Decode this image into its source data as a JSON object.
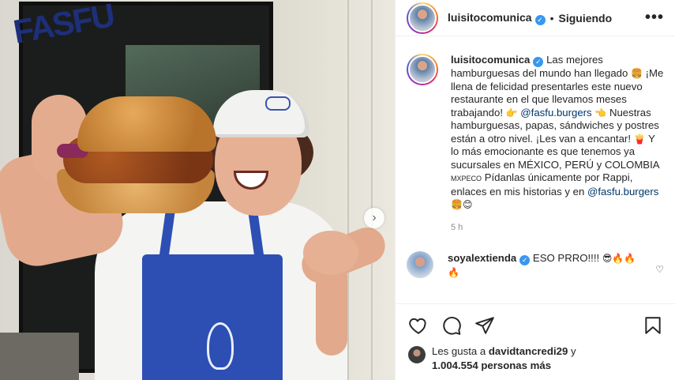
{
  "post": {
    "author": "luisitocomunica",
    "follow_status": "Siguiendo",
    "more_options": "•••",
    "separator": "•",
    "caption": {
      "part1": "Las mejores hamburguesas del mundo han llegado",
      "emoji1": "🍔",
      "part2": "¡Me llena de felicidad presentarles este nuevo restaurante en el que llevamos meses trabajando!",
      "emoji2": "👉",
      "mention1": "@fasfu.burgers",
      "emoji3": "👈",
      "part3": "Nuestras hamburguesas, papas, sándwiches y postres están a otro nivel. ¡Les van a encantar!",
      "emoji4": "🍟",
      "part4": "Y lo más emocionante es que tenemos ya sucursales en MÉXICO, PERÚ y COLOMBIA",
      "flags": "MXPECO",
      "part5": "Pídanlas únicamente por Rappi, enlaces en mis historias y en",
      "mention2": "@fasfu.burgers",
      "emoji5": "🍔😊"
    },
    "timestamp": "5 h",
    "comment": {
      "user": "soyalextienda",
      "text": "ESO PRRO!!!!",
      "emojis": "😎🔥🔥🔥"
    },
    "likes": {
      "prefix": "Les gusta a",
      "user": "davidtancredi29",
      "connector": "y",
      "count": "1.004.554 personas más"
    },
    "photo": {
      "sign_text": "FASFU"
    }
  },
  "icons": {
    "verified": "✓",
    "next": "›",
    "comment_heart": "♡"
  }
}
